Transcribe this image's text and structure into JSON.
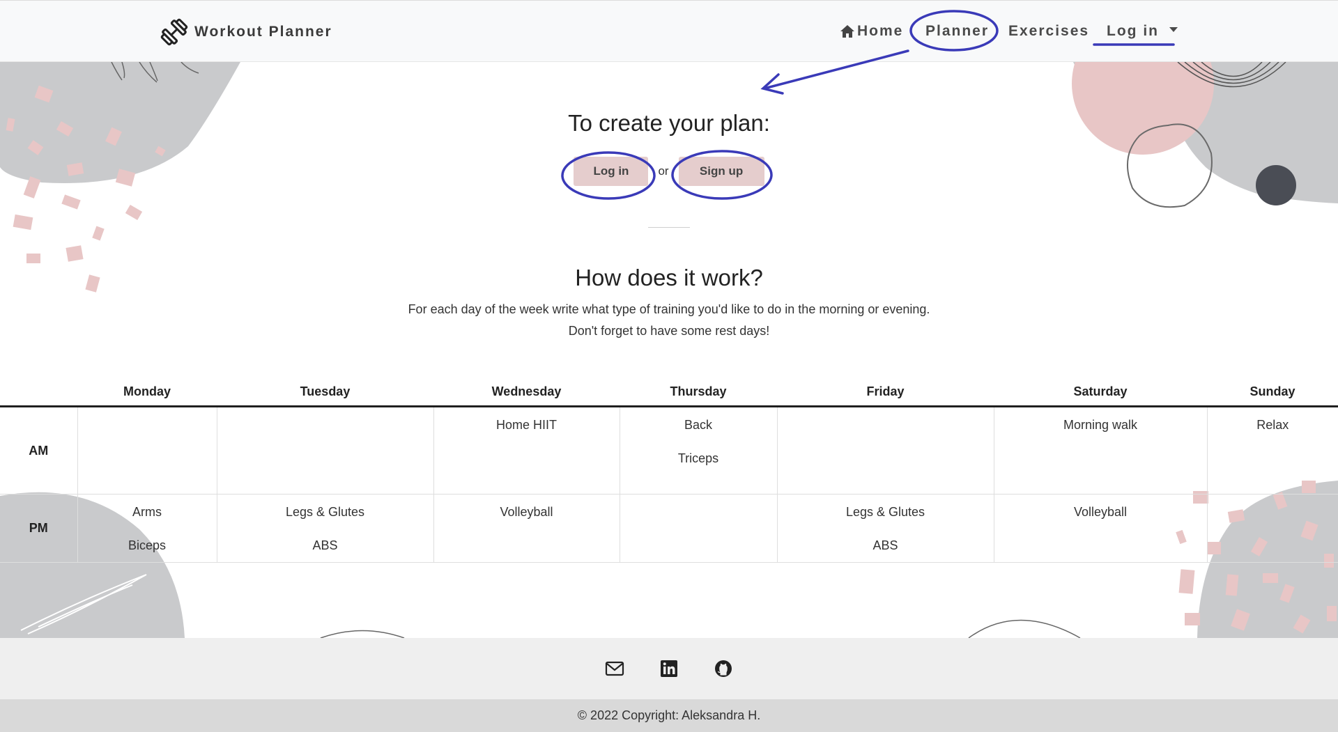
{
  "navbar": {
    "brand": "Workout Planner",
    "links": {
      "home": "Home",
      "planner": "Planner",
      "exercises": "Exercises",
      "login": "Log in"
    }
  },
  "cta": {
    "heading": "To create your plan:",
    "login_button": "Log in",
    "or_text": "or",
    "signup_button": "Sign up"
  },
  "how": {
    "heading": "How does it work?",
    "line1": "For each day of the week write what type of training you'd like to do in the morning or evening.",
    "line2": "Don't forget to have some rest days!"
  },
  "plan": {
    "days": [
      "Monday",
      "Tuesday",
      "Wednesday",
      "Thursday",
      "Friday",
      "Saturday",
      "Sunday"
    ],
    "rows": [
      {
        "label": "AM",
        "cells": [
          [],
          [],
          [
            "Home HIIT"
          ],
          [
            "Back",
            "Triceps"
          ],
          [],
          [
            "Morning walk"
          ],
          [
            "Relax"
          ]
        ]
      },
      {
        "label": "PM",
        "cells": [
          [
            "Arms",
            "Biceps"
          ],
          [
            "Legs & Glutes",
            "ABS"
          ],
          [
            "Volleyball"
          ],
          [],
          [
            "Legs & Glutes",
            "ABS"
          ],
          [
            "Volleyball"
          ],
          []
        ]
      }
    ]
  },
  "footer": {
    "icons": [
      "envelope-icon",
      "linkedin-icon",
      "github-icon"
    ],
    "copyright": "© 2022 Copyright: Aleksandra H."
  },
  "colors": {
    "button_bg": "#e5cdcd",
    "blob_gray": "#c9cacc",
    "blob_pink": "#e8c6c6",
    "dot_dark": "#4a4d55",
    "annotation_blue": "#3a3ab8"
  }
}
